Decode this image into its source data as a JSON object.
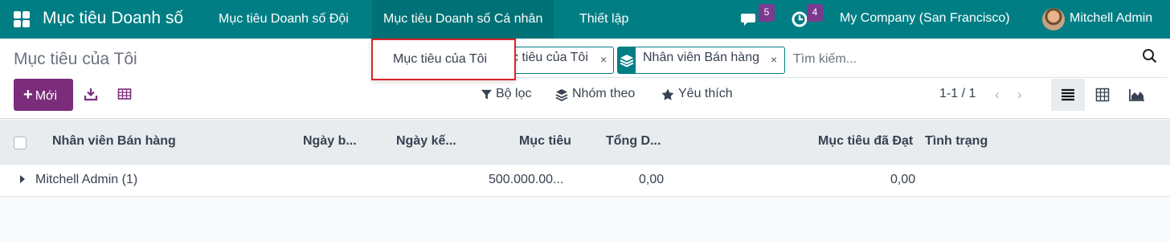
{
  "navbar": {
    "brand": "Mục tiêu Doanh số",
    "menus": [
      "Mục tiêu Doanh số Đội",
      "Mục tiêu Doanh số Cá nhân",
      "Thiết lập"
    ],
    "messages_count": "5",
    "activities_count": "4",
    "company": "My Company (San Francisco)",
    "user": "Mitchell Admin"
  },
  "control_panel": {
    "title": "Mục tiêu của Tôi",
    "facets": [
      {
        "label": "Mục tiêu của Tôi",
        "visible_text": "c tiêu của Tôi",
        "icon": "filter-icon"
      },
      {
        "label": "Nhân viên Bán hàng",
        "icon": "layers-icon"
      }
    ],
    "facet_remove": "×",
    "search_placeholder": "Tìm kiếm...",
    "new_label": "Mới",
    "new_plus": "+",
    "filters_label": "Bộ lọc",
    "group_by_label": "Nhóm theo",
    "favorites_label": "Yêu thích",
    "pager": "1-1 / 1",
    "prev": "‹",
    "next": "›"
  },
  "dropdown": {
    "item": "Mục tiêu của Tôi"
  },
  "table": {
    "columns": [
      "Nhân viên Bán hàng",
      "Ngày b...",
      "Ngày kế...",
      "Mục tiêu",
      "Tổng D...",
      "Mục tiêu đã Đạt",
      "Tình trạng"
    ],
    "group_row": {
      "label": "Mitchell Admin (1)",
      "target": "500.000.00...",
      "total": "0,00",
      "achieved": "0,00"
    }
  },
  "colors": {
    "navbar": "#017e84",
    "primary_button": "#7b2d7c",
    "highlight_border": "#d9262a"
  }
}
